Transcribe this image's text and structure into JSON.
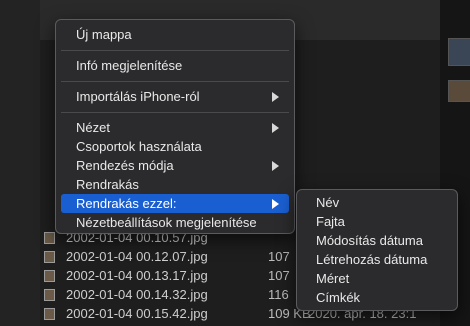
{
  "menu": {
    "items": [
      {
        "label": "Új mappa",
        "submenu": false
      },
      {
        "label": "Infó megjelenítése",
        "submenu": false
      },
      {
        "label": "Importálás iPhone-ról",
        "submenu": true
      },
      {
        "label": "Nézet",
        "submenu": true
      },
      {
        "label": "Csoportok használata",
        "submenu": false
      },
      {
        "label": "Rendezés módja",
        "submenu": true
      },
      {
        "label": "Rendrakás",
        "submenu": false
      },
      {
        "label": "Rendrakás ezzel:",
        "submenu": true,
        "highlighted": true
      },
      {
        "label": "Nézetbeállítások megjelenítése",
        "submenu": false
      }
    ]
  },
  "submenu": {
    "items": [
      "Név",
      "Fajta",
      "Módosítás dátuma",
      "Létrehozás dátuma",
      "Méret",
      "Címkék"
    ]
  },
  "files": [
    {
      "name": "2002-01-04 00.10.57.jpg",
      "size": "",
      "date": ""
    },
    {
      "name": "2002-01-04 00.12.07.jpg",
      "size": "107",
      "date": ""
    },
    {
      "name": "2002-01-04 00.13.17.jpg",
      "size": "107",
      "date": ""
    },
    {
      "name": "2002-01-04 00.14.32.jpg",
      "size": "116",
      "date": ""
    },
    {
      "name": "2002-01-04 00.15.42.jpg",
      "size": "109 KB",
      "date": "2020. ápr. 18. 23:1"
    }
  ],
  "colors": {
    "highlight": "#1a5fd1",
    "menu_bg": "#2b2b2d"
  }
}
